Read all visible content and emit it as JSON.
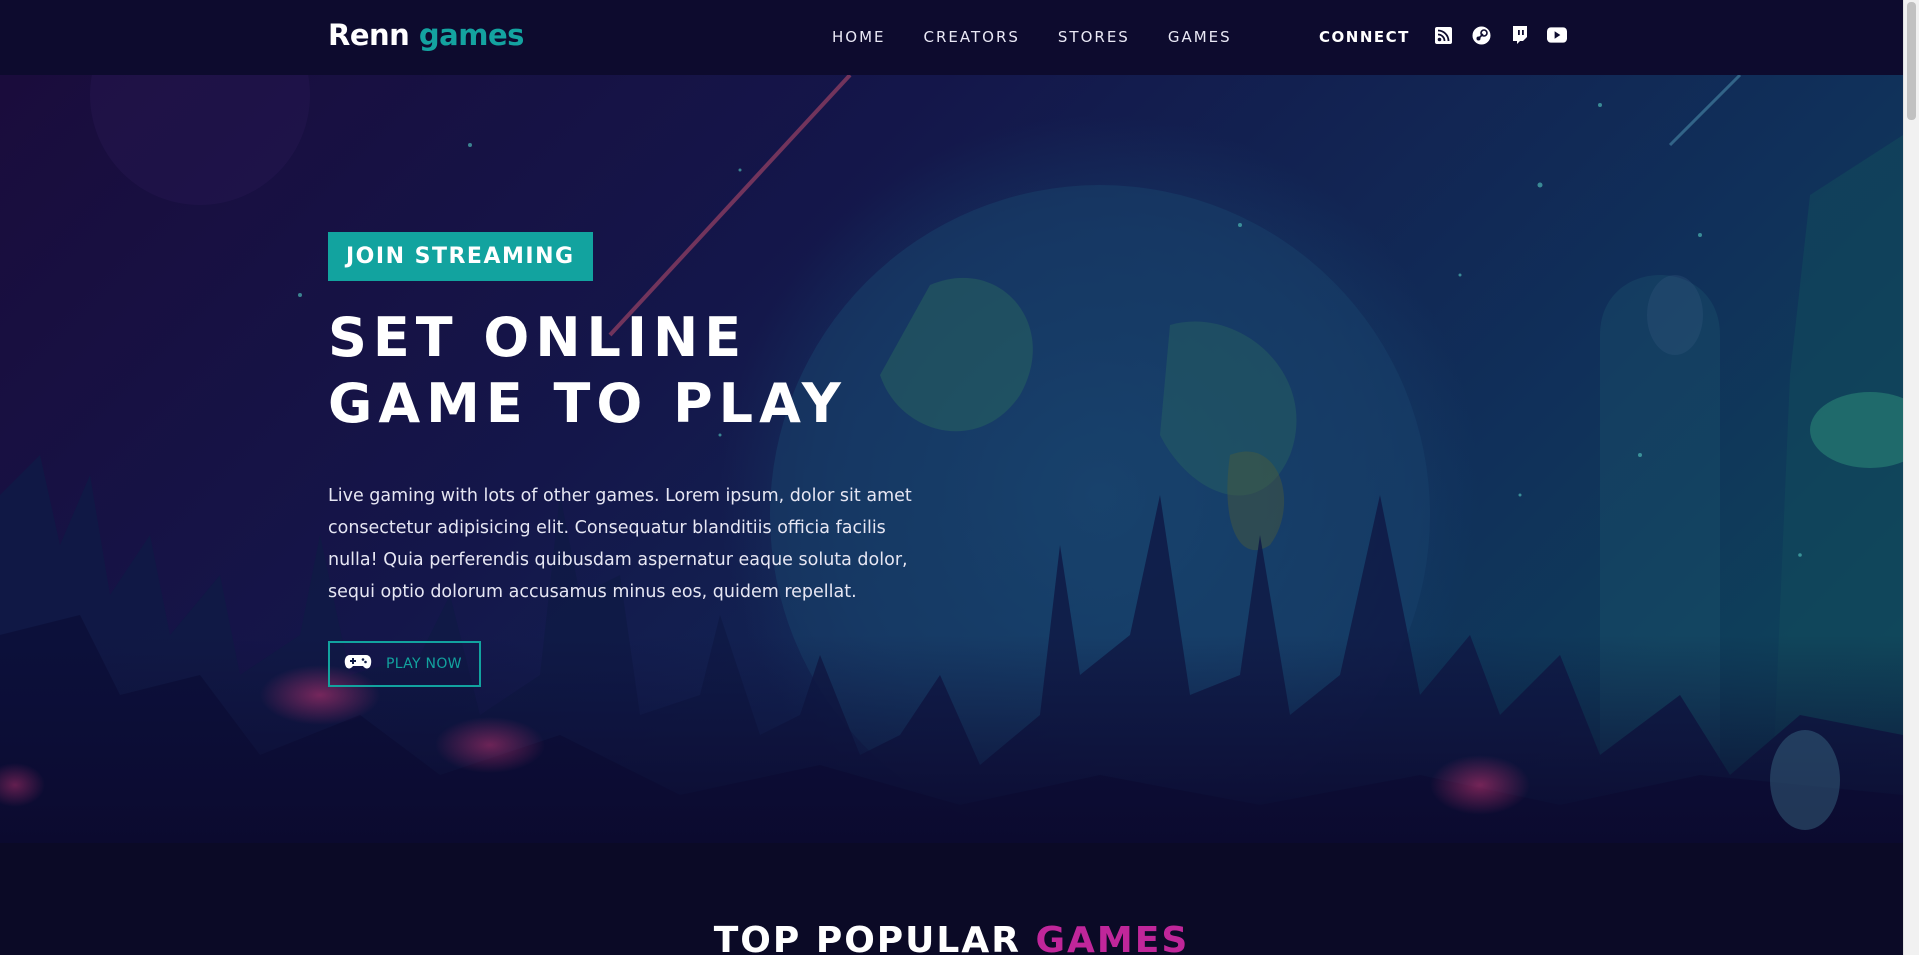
{
  "logo": {
    "first": "Renn",
    "second": "games"
  },
  "nav": {
    "links": [
      "HOME",
      "CREATORS",
      "STORES",
      "GAMES"
    ],
    "connect": "CONNECT",
    "social_icons": [
      "rss-icon",
      "steam-icon",
      "twitch-icon",
      "youtube-icon"
    ]
  },
  "hero": {
    "badge": "JOIN STREAMING",
    "title": "SET ONLINE GAME TO PLAY",
    "text": "Live gaming with lots of other games. Lorem ipsum, dolor sit amet consectetur adipisicing elit. Consequatur blanditiis officia facilis nulla! Quia perferendis quibusdam aspernatur eaque soluta dolor, sequi optio dolorum accusamus minus eos, quidem repellat.",
    "button_label": "PLAY NOW",
    "button_icon": "gamepad-icon"
  },
  "section": {
    "title_a": "TOP POPULAR",
    "title_b": "GAMES"
  },
  "colors": {
    "accent": "#12a39f",
    "magenta": "#c0269a",
    "navbar_bg": "#0d0b2e",
    "page_bg": "#0b0a26"
  }
}
